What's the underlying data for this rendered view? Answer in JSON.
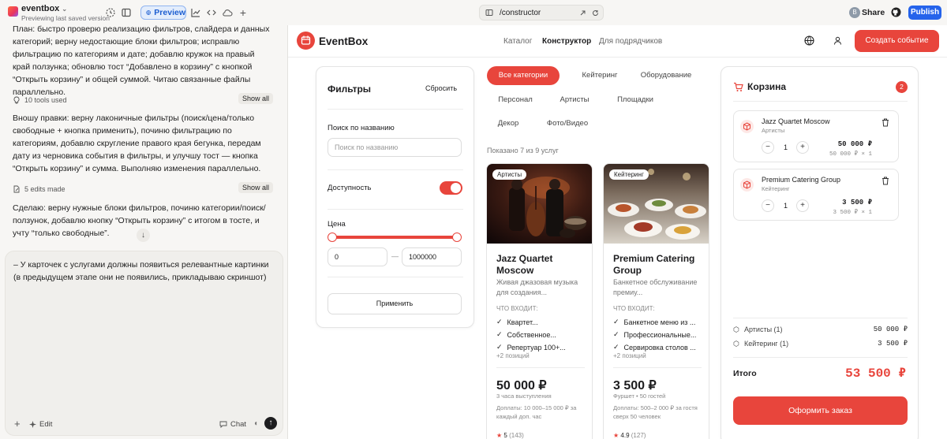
{
  "app": {
    "project_name": "eventbox",
    "project_status": "Previewing last saved version",
    "preview_label": "Preview",
    "url": "/constructor",
    "share_label": "Share",
    "publish_label": "Publish",
    "avatar_initial": "B"
  },
  "chat": {
    "messages": [
      "План: быстро проверю реализацию фильтров, слайдера и данных категорий; верну недостающие блоки фильтров; исправлю фильтрацию по категориям и дате; добавлю кружок на правый край ползунка; обновлю тост “Добавлено в корзину” с кнопкой “Открыть корзину” и общей суммой. Читаю связанные файлы параллельно.",
      "Вношу правки: верну лаконичные фильтры (поиск/цена/только свободные + кнопка применить), починю фильтрацию по категориям, добавлю скругление правого края бегунка, передам дату из черновика события в фильтры, и улучшу тост — кнопка “Открыть корзину” и сумма. Выполняю изменения параллельно.",
      "Сделаю: верну нужные блоки фильтров, починю категории/поиск/ползунок, добавлю кнопку “Открыть корзину” с итогом в тосте, и учту “только свободные”."
    ],
    "tools_used": "10 tools used",
    "edits_made": "5 edits made",
    "show_all": "Show all",
    "composer_text": "– У карточек с услугами должны появиться релевантные картинки (в предыдущем этапе они не появились, прикладываю скриншот)",
    "edit_label": "Edit",
    "chat_label": "Chat"
  },
  "site": {
    "brand": "EventBox",
    "nav": [
      "Каталог",
      "Конструктор",
      "Для подрядчиков"
    ],
    "create_event": "Создать событие"
  },
  "filters": {
    "title": "Фильтры",
    "reset": "Сбросить",
    "search_label": "Поиск по названию",
    "search_placeholder": "Поиск по названию",
    "availability_label": "Доступность",
    "availability_on": true,
    "price_label": "Цена",
    "price_min": "0",
    "price_max": "1000000",
    "price_dash": "—",
    "apply": "Применить"
  },
  "categories": {
    "items": [
      "Все категории",
      "Кейтеринг",
      "Оборудование",
      "Персонал",
      "Артисты",
      "Площадки",
      "Декор",
      "Фото/Видео"
    ],
    "active_index": 0,
    "shown": "Показано 7 из 9 услуг"
  },
  "cards": [
    {
      "badge": "Артисты",
      "title": "Jazz Quartet Moscow",
      "desc": "Живая джазовая музыка для создания...",
      "includes_label": "ЧТО ВХОДИТ:",
      "includes": [
        "Квартет...",
        "Собственное...",
        "Репертуар 100+..."
      ],
      "more": "+2 позиций",
      "price": "50 000 ₽",
      "sub": "3 часа выступления",
      "extra": "Доплаты: 10 000–15 000 ₽ за каждый доп. час",
      "rating": "5",
      "reviews": "(143)"
    },
    {
      "badge": "Кейтеринг",
      "title": "Premium Catering Group",
      "desc": "Банкетное обслуживание премиу...",
      "includes_label": "ЧТО ВХОДИТ:",
      "includes": [
        "Банкетное меню из ...",
        "Профессиональные...",
        "Сервировка столов ..."
      ],
      "more": "+2 позиций",
      "price": "3 500 ₽",
      "sub": "Фуршет • 50 гостей",
      "extra": "Доплаты: 500–2 000 ₽ за гостя сверх 50 человек",
      "rating": "4.9",
      "reviews": "(127)"
    }
  ],
  "cart": {
    "title": "Корзина",
    "count": "2",
    "items": [
      {
        "name": "Jazz Quartet Moscow",
        "category": "Артисты",
        "qty": "1",
        "price": "50 000 ₽",
        "sub": "50 000 ₽ × 1"
      },
      {
        "name": "Premium Catering Group",
        "category": "Кейтеринг",
        "qty": "1",
        "price": "3 500 ₽",
        "sub": "3 500 ₽ × 1"
      }
    ],
    "summary": [
      {
        "label": "Артисты (1)",
        "value": "50 000 ₽"
      },
      {
        "label": "Кейтеринг (1)",
        "value": "3 500 ₽"
      }
    ],
    "total_label": "Итого",
    "total_value": "53 500 ₽",
    "checkout": "Оформить заказ"
  },
  "colors": {
    "accent": "#e8453c",
    "publish": "#2563eb"
  }
}
